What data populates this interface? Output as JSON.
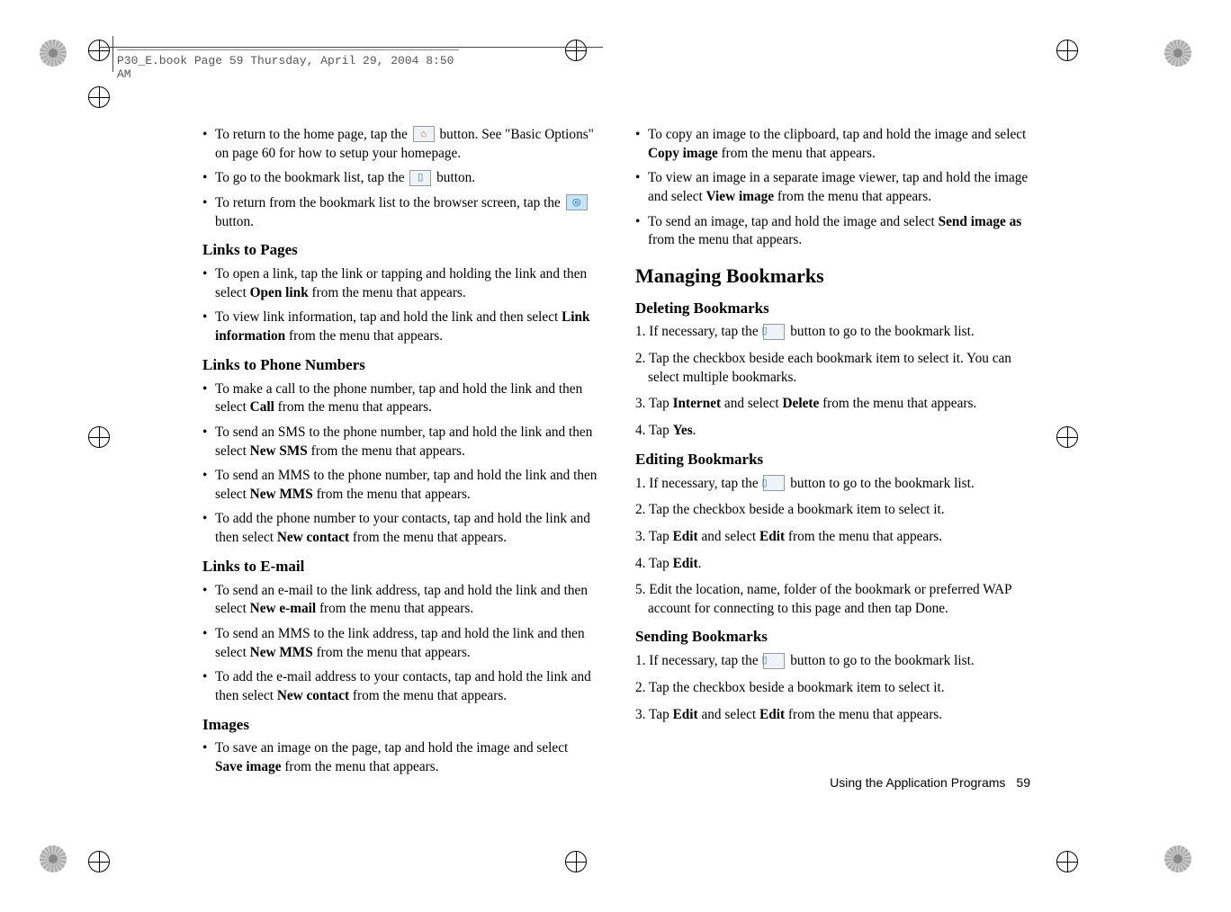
{
  "meta": {
    "header_path": "P30_E.book  Page 59  Thursday, April 29, 2004  8:50 AM"
  },
  "col1": {
    "b1a": "To return to the home page, tap the ",
    "b1b": " button. See \"Basic Options\" on page 60 for how to setup your homepage.",
    "b2a": "To go to the bookmark list, tap the ",
    "b2b": " button.",
    "b3a": "To return from the bookmark list to the browser screen, tap the ",
    "b3b": " button.",
    "h_links_pages": "Links to Pages",
    "lp1a": "To open a link, tap the link or tapping and holding the link and then select ",
    "lp1_bold": "Open link",
    "lp1b": " from the menu that appears.",
    "lp2a": "To view link information, tap and hold the link and then select ",
    "lp2_bold": "Link information",
    "lp2b": " from the menu that appears.",
    "h_links_phone": "Links to Phone Numbers",
    "ph1a": "To make a call to the phone number, tap and hold the link and then select ",
    "ph1_bold": "Call",
    "ph1b": " from the menu that appears.",
    "ph2a": "To send an SMS to the phone number, tap and hold the link and then select ",
    "ph2_bold": "New SMS",
    "ph2b": " from the menu that appears.",
    "ph3a": "To send an MMS to the phone number, tap and hold the link and then select ",
    "ph3_bold": "New MMS",
    "ph3b": " from the menu that appears.",
    "ph4a": "To add the phone number to your contacts, tap and hold the link and then select ",
    "ph4_bold": "New contact",
    "ph4b": " from the menu that appears.",
    "h_links_email": "Links to E-mail",
    "em1a": "To send an e-mail to the link address, tap and hold the link and then select ",
    "em1_bold": "New e-mail",
    "em1b": " from the menu that appears.",
    "em2a": "To send an MMS to the link address, tap and hold the link and then select ",
    "em2_bold": "New MMS",
    "em2b": " from the menu that appears.",
    "em3a": "To add the e-mail address to your contacts, tap and hold the link and then select ",
    "em3_bold": "New contact",
    "em3b": " from the menu that appears.",
    "h_images": "Images",
    "im1a": "To save an image on the page, tap and hold the image and select ",
    "im1_bold": "Save image",
    "im1b": " from the menu that appears."
  },
  "col2": {
    "im2a": "To copy an image to the clipboard, tap and hold the image and select ",
    "im2_bold": "Copy image",
    "im2b": " from the menu that appears.",
    "im3a": "To view an image in a separate image viewer, tap and hold the image and select ",
    "im3_bold": "View image",
    "im3b": " from the menu that appears.",
    "im4a": "To send an image, tap and hold the image and select ",
    "im4_bold": "Send image as",
    "im4b": " from the menu that appears.",
    "h_managing": "Managing Bookmarks",
    "h_deleting": "Deleting Bookmarks",
    "d1a": "1. If necessary, tap the ",
    "d1b": " button to go to the bookmark list.",
    "d2": "2. Tap the checkbox beside each bookmark item to select it. You can select multiple bookmarks.",
    "d3a": "3. Tap ",
    "d3_b1": "Internet",
    "d3m": " and select ",
    "d3_b2": "Delete",
    "d3b": " from the menu that appears.",
    "d4a": "4. Tap ",
    "d4_b": "Yes",
    "d4b": ".",
    "h_editing": "Editing Bookmarks",
    "e1a": "1. If necessary, tap the ",
    "e1b": " button to go to the bookmark list.",
    "e2": "2. Tap the checkbox beside a bookmark item to select it.",
    "e3a": "3. Tap ",
    "e3_b1": "Edit",
    "e3m": " and select ",
    "e3_b2": "Edit",
    "e3b": " from the menu that appears.",
    "e4a": "4. Tap ",
    "e4_b": "Edit",
    "e4b": ".",
    "e5": "5. Edit the location, name, folder of the bookmark or preferred WAP account for connecting to this page and then tap Done.",
    "h_sending": "Sending Bookmarks",
    "s1a": "1. If necessary, tap the ",
    "s1b": " button to go to the bookmark list.",
    "s2": "2. Tap the checkbox beside a bookmark item to select it.",
    "s3a": "3. Tap ",
    "s3_b1": "Edit",
    "s3m": " and select ",
    "s3_b2": "Edit",
    "s3b": " from the menu that appears."
  },
  "footer": {
    "label": "Using the Application Programs",
    "page": "59"
  },
  "icons": {
    "home": "⌂",
    "bookmark": "▯",
    "search": "◎"
  }
}
